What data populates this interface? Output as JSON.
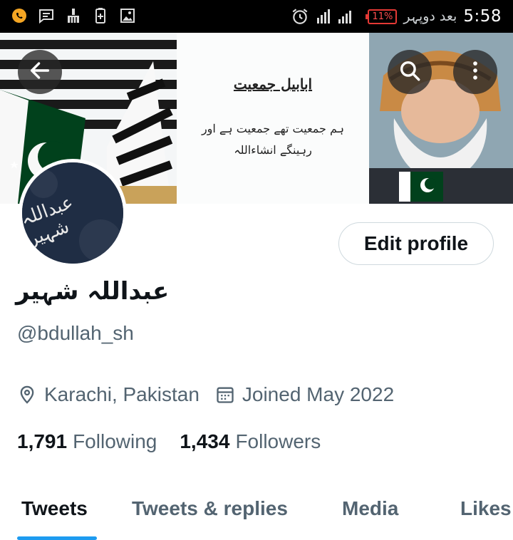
{
  "status_bar": {
    "time": "5:58",
    "period": "بعد دوپہر",
    "battery": "11%",
    "icons": [
      "whatsapp-icon",
      "message-icon",
      "broom-icon",
      "battery-saver-icon",
      "image-icon",
      "alarm-icon",
      "signal-icon"
    ]
  },
  "banner": {
    "title": "ابابیل جمعیت",
    "line1": "ہم جمعیت تھے جمعیت ہے اور",
    "line2": "رہینگے انشاءاللہ"
  },
  "avatar": {
    "text": "عبداللہ شہیر"
  },
  "profile": {
    "display_name": "عبداللہ شہیر",
    "handle": "@bdullah_sh",
    "location": "Karachi, Pakistan",
    "joined": "Joined May 2022",
    "following_count": "1,791",
    "following_label": "Following",
    "followers_count": "1,434",
    "followers_label": "Followers"
  },
  "actions": {
    "edit_profile": "Edit profile"
  },
  "tabs": [
    {
      "label": "Tweets",
      "active": true
    },
    {
      "label": "Tweets & replies",
      "active": false
    },
    {
      "label": "Media",
      "active": false
    },
    {
      "label": "Likes",
      "active": false
    }
  ],
  "colors": {
    "accent": "#1d9bf0",
    "text_primary": "#0f1419",
    "text_secondary": "#536471",
    "battery_low": "#e53935",
    "pakistan_green": "#01411c"
  }
}
